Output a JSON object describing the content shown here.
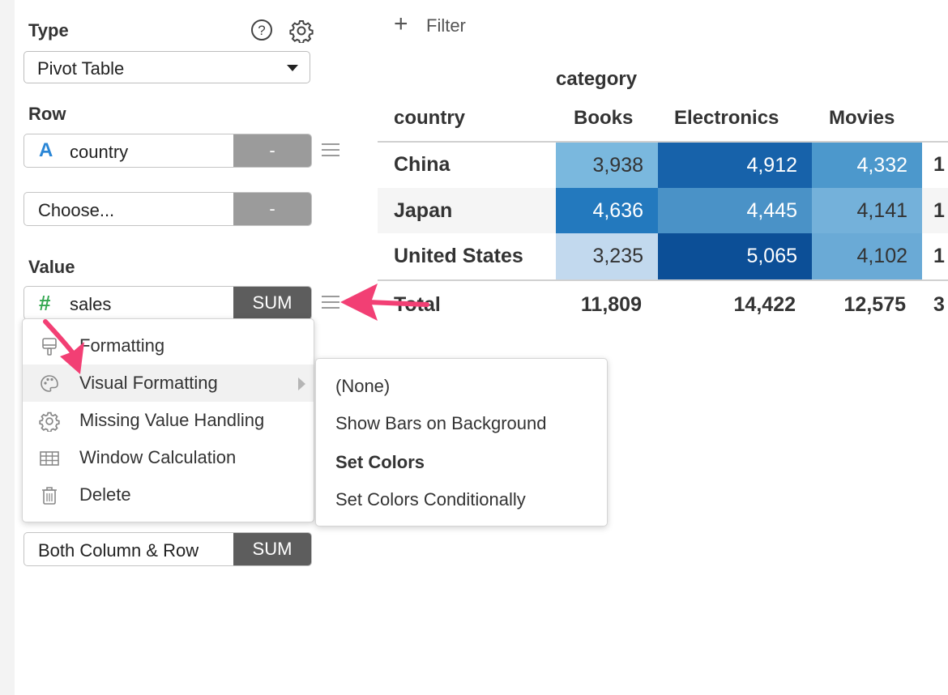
{
  "sidebar": {
    "type_title": "Type",
    "chart_type": "Pivot Table",
    "row_title": "Row",
    "row_field": "country",
    "row_field_btn": "-",
    "row_choose": "Choose...",
    "row_choose_btn": "-",
    "value_title": "Value",
    "value_field": "sales",
    "value_agg": "SUM",
    "total_label": "Both Column & Row",
    "total_agg": "SUM"
  },
  "filter": {
    "label": "Filter"
  },
  "table": {
    "column_group": "category",
    "row_header": "country",
    "columns": [
      "Books",
      "Electronics",
      "Movies"
    ],
    "rows": [
      {
        "label": "China",
        "values": [
          "3,938",
          "4,912",
          "4,332"
        ]
      },
      {
        "label": "Japan",
        "values": [
          "4,636",
          "4,445",
          "4,141"
        ]
      },
      {
        "label": "United States",
        "values": [
          "3,235",
          "5,065",
          "4,102"
        ]
      }
    ],
    "total_label": "Total",
    "totals": [
      "11,809",
      "14,422",
      "12,575"
    ],
    "overflow_glyphs": [
      "1",
      "1",
      "1",
      "3"
    ]
  },
  "context_menu": {
    "items": [
      {
        "label": "Formatting",
        "icon": "paintbrush-icon"
      },
      {
        "label": "Visual Formatting",
        "icon": "palette-icon"
      },
      {
        "label": "Missing Value Handling",
        "icon": "gear-icon"
      },
      {
        "label": "Window Calculation",
        "icon": "table-icon"
      },
      {
        "label": "Delete",
        "icon": "trash-icon"
      }
    ]
  },
  "submenu": {
    "items": [
      "(None)",
      "Show Bars on Background",
      "Set Colors",
      "Set Colors Conditionally"
    ]
  },
  "colors": {
    "cells": [
      [
        "#7ab8de",
        "#1762aa",
        "#4c98cc"
      ],
      [
        "#2379be",
        "#4a92c7",
        "#74b1da"
      ],
      [
        "#c2d9ee",
        "#0c4f97",
        "#6aaad6"
      ]
    ],
    "annotation_arrow": "#f23f74"
  }
}
